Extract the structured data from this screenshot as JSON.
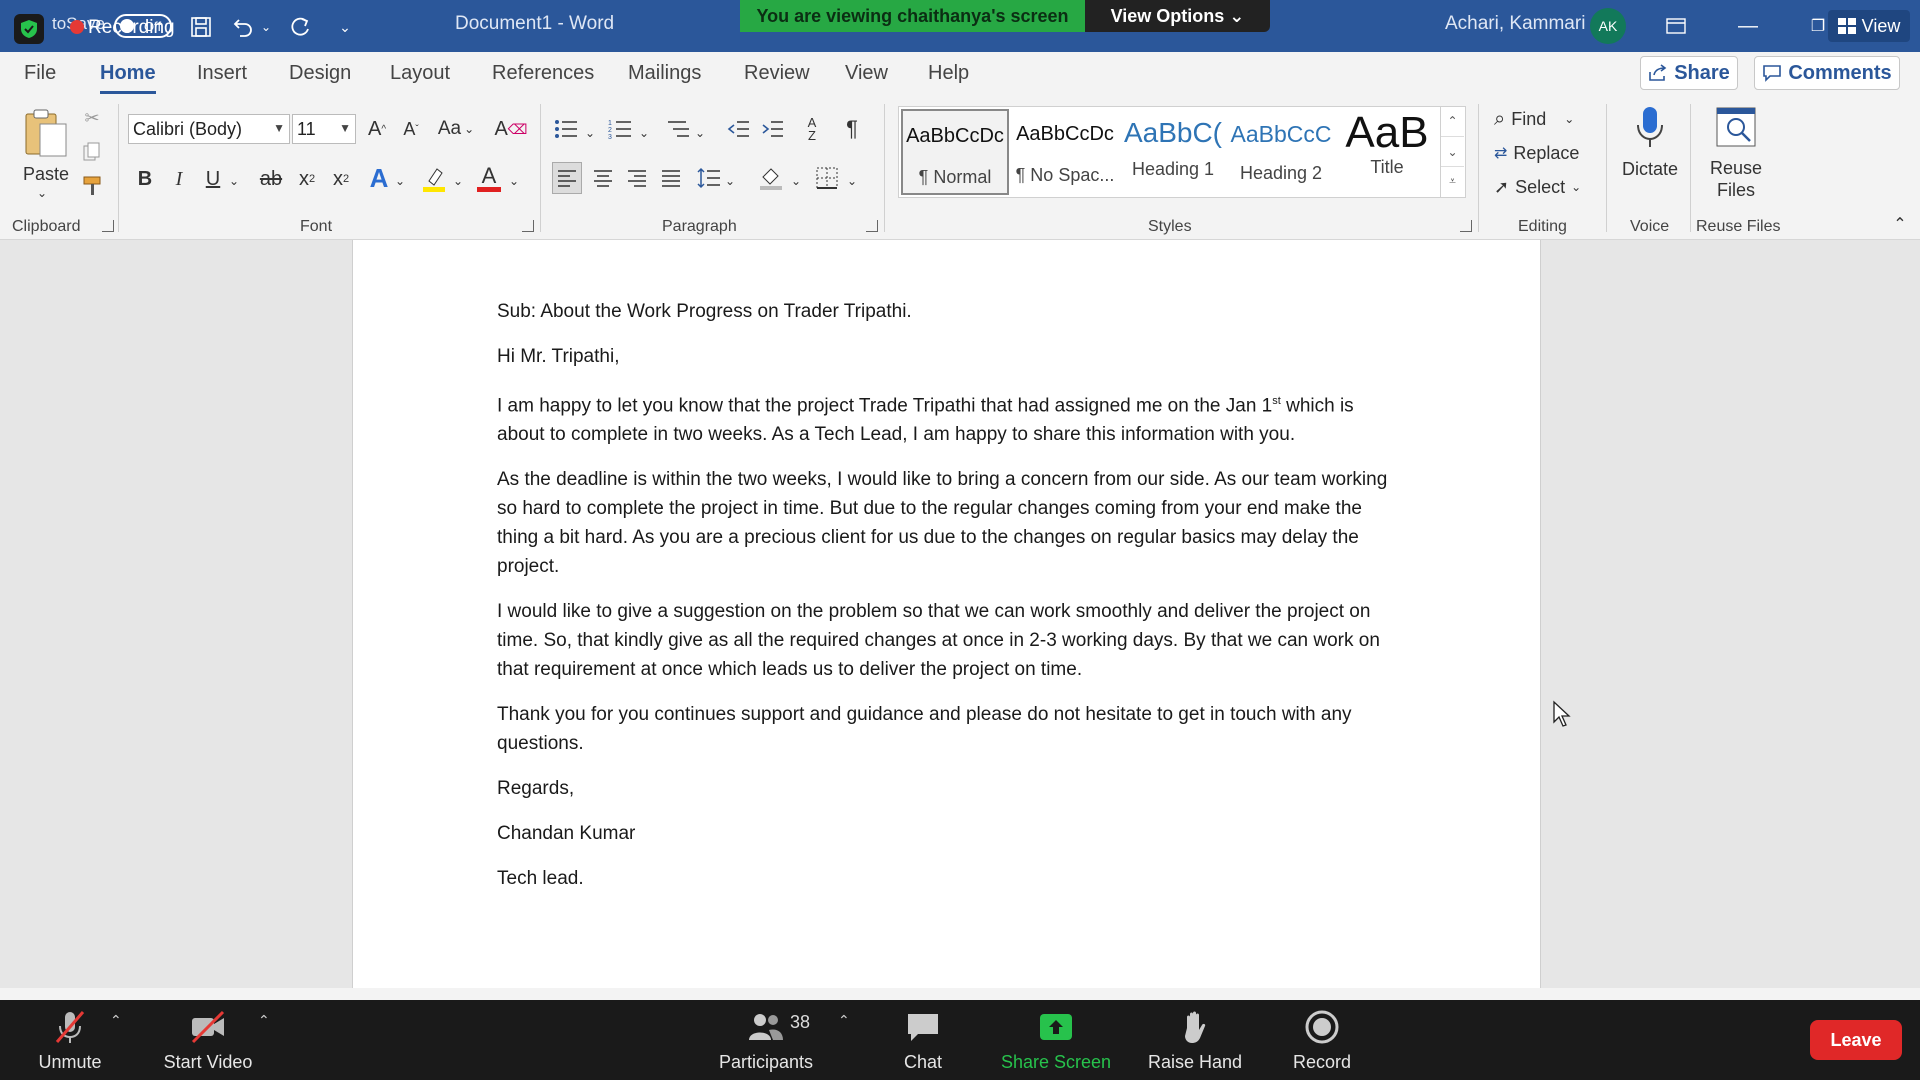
{
  "titlebar": {
    "autosave_label": "toSave",
    "recording_label": "Recording",
    "toggle_label": "Off",
    "doc_title": "Document1  -  Word",
    "share_banner": "You are viewing chaithanya's screen",
    "view_options": "View Options ⌄",
    "user_name": "Achari, Kammari",
    "avatar_initials": "AK",
    "view_button": "View"
  },
  "tabs": [
    "File",
    "Home",
    "Insert",
    "Design",
    "Layout",
    "References",
    "Mailings",
    "Review",
    "View",
    "Help"
  ],
  "share_label": "Share",
  "comments_label": "Comments",
  "ribbon": {
    "clipboard": {
      "paste": "Paste",
      "label": "Clipboard"
    },
    "font": {
      "family": "Calibri (Body)",
      "size": "11",
      "label": "Font",
      "case_btn": "Aa"
    },
    "paragraph": {
      "label": "Paragraph"
    },
    "styles": {
      "label": "Styles",
      "items": [
        {
          "preview": "AaBbCcDc",
          "name": "¶ Normal"
        },
        {
          "preview": "AaBbCcDc",
          "name": "¶ No Spac..."
        },
        {
          "preview": "AaBbC(",
          "name": "Heading 1"
        },
        {
          "preview": "AaBbCcC",
          "name": "Heading 2"
        },
        {
          "preview": "AaB",
          "name": "Title"
        }
      ]
    },
    "editing": {
      "find": "Find",
      "replace": "Replace",
      "select": "Select",
      "label": "Editing"
    },
    "voice": {
      "dictate": "Dictate",
      "label": "Voice"
    },
    "reuse": {
      "button": "Reuse Files",
      "label": "Reuse Files"
    }
  },
  "document": {
    "subject": "Sub: About the Work Progress on Trader Tripathi.",
    "greeting": "Hi Mr. Tripathi,",
    "p1_before_sup": "I am happy to let you know that the project Trade Tripathi that had assigned me on the Jan 1",
    "p1_sup": "st",
    "p1_after_sup": " which is about to complete in two weeks. As a Tech Lead, I am happy to share this information with you.",
    "p2": "As the deadline is within the two weeks, I would like to bring a concern from our side. As our team working so hard to complete the project in time. But due to the regular changes coming from your end make the thing a bit hard. As you are a precious client for us due to the changes on regular basics may delay the project.",
    "p3": "I would like to give a suggestion on the problem so that we can work smoothly and deliver the project on time. So, that kindly give as all the required changes at once in 2-3 working days. By that we can work on that requirement at once which leads us to deliver the project on time.",
    "p4": "Thank you for you continues support and guidance and please do not hesitate to get in touch with any questions.",
    "closing": "Regards,",
    "name": "Chandan Kumar",
    "role": "Tech lead."
  },
  "zoom": {
    "unmute": "Unmute",
    "start_video": "Start Video",
    "participants": "Participants",
    "participant_count": "38",
    "chat": "Chat",
    "share_screen": "Share Screen",
    "raise_hand": "Raise Hand",
    "record": "Record",
    "leave": "Leave"
  },
  "colors": {
    "word_blue": "#2b579a",
    "share_green": "#27a844",
    "leave_red": "#e02828"
  }
}
